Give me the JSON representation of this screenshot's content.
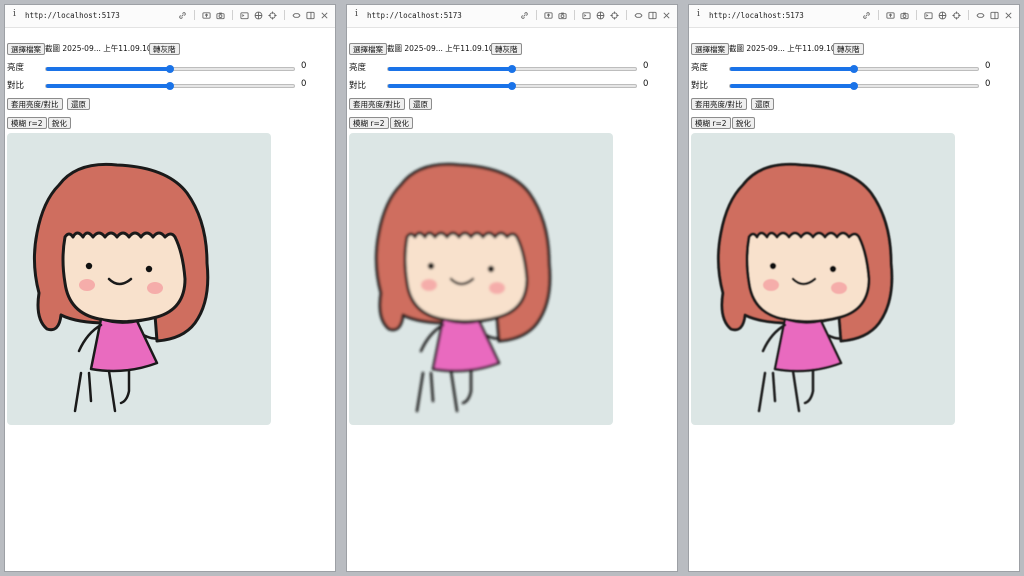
{
  "windows": [
    {
      "url": "http://localhost:5173",
      "choose_file": "選擇檔案",
      "file_name": "截圖 2025-09... 上午11.09.10",
      "grayscale": "轉灰階",
      "brightness_label": "亮度",
      "brightness_value": "0",
      "brightness_level": 0.5,
      "contrast_label": "對比",
      "contrast_value": "0",
      "contrast_level": 0.5,
      "apply": "套用亮度/對比",
      "reset": "還原",
      "blur": "模糊 r=2",
      "sharpen": "銳化",
      "image_state": "normal"
    },
    {
      "url": "http://localhost:5173",
      "choose_file": "選擇檔案",
      "file_name": "截圖 2025-09... 上午11.09.10",
      "grayscale": "轉灰階",
      "brightness_label": "亮度",
      "brightness_value": "0",
      "brightness_level": 0.5,
      "contrast_label": "對比",
      "contrast_value": "0",
      "contrast_level": 0.5,
      "apply": "套用亮度/對比",
      "reset": "還原",
      "blur": "模糊 r=2",
      "sharpen": "銳化",
      "image_state": "blurred"
    },
    {
      "url": "http://localhost:5173",
      "choose_file": "選擇檔案",
      "file_name": "截圖 2025-09... 上午11.09.10",
      "grayscale": "轉灰階",
      "brightness_label": "亮度",
      "brightness_value": "0",
      "brightness_level": 0.5,
      "contrast_label": "對比",
      "contrast_value": "0",
      "contrast_level": 0.5,
      "apply": "套用亮度/對比",
      "reset": "還原",
      "blur": "模糊 r=2",
      "sharpen": "銳化",
      "image_state": "sharpened"
    }
  ],
  "colors": {
    "accent": "#1a73e8",
    "canvas_bg": "#dce6e5",
    "hair": "#cf6e5f",
    "face": "#f8e1cc",
    "cheek": "#f5a3a3",
    "dress": "#e96bbf"
  },
  "icons": [
    "info-icon",
    "link-icon",
    "screen-share-icon",
    "camera-icon",
    "terminal-icon",
    "globe-icon",
    "crosshair-icon",
    "swap-icon",
    "split-view-icon",
    "close-icon"
  ]
}
